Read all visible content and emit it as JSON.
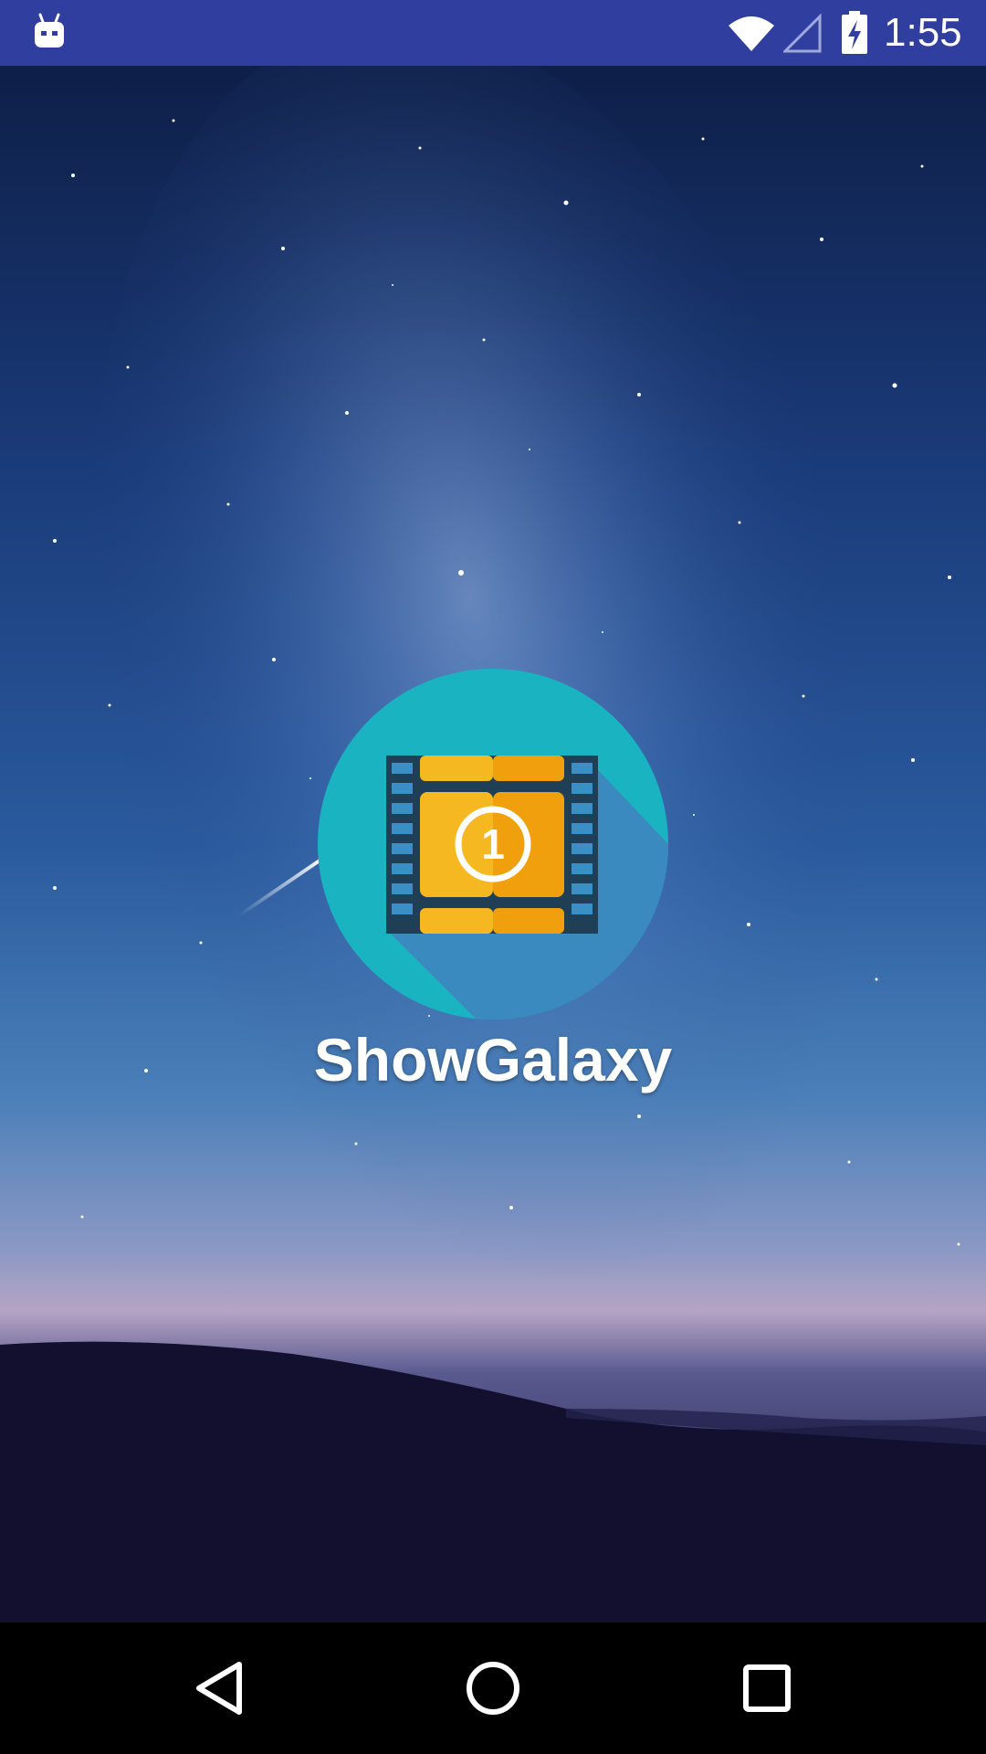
{
  "status_bar": {
    "time": "1:55",
    "notification_icon": "android-debug-icon",
    "icons": [
      "wifi-icon",
      "signal-icon",
      "battery-charging-icon"
    ],
    "background_color": "#303f9f"
  },
  "splash": {
    "app_name": "ShowGalaxy",
    "logo_icon": "film-strip-icon",
    "logo_badge_text": "1",
    "colors": {
      "logo_circle": "#1ab3c2",
      "logo_shadow": "#3a89bf",
      "film_frame": "#f5b820",
      "film_frame_dark": "#f0a00d",
      "night_sky": "#1a3a78"
    }
  },
  "nav_bar": {
    "buttons": [
      "back-icon",
      "home-icon",
      "recents-icon"
    ]
  }
}
